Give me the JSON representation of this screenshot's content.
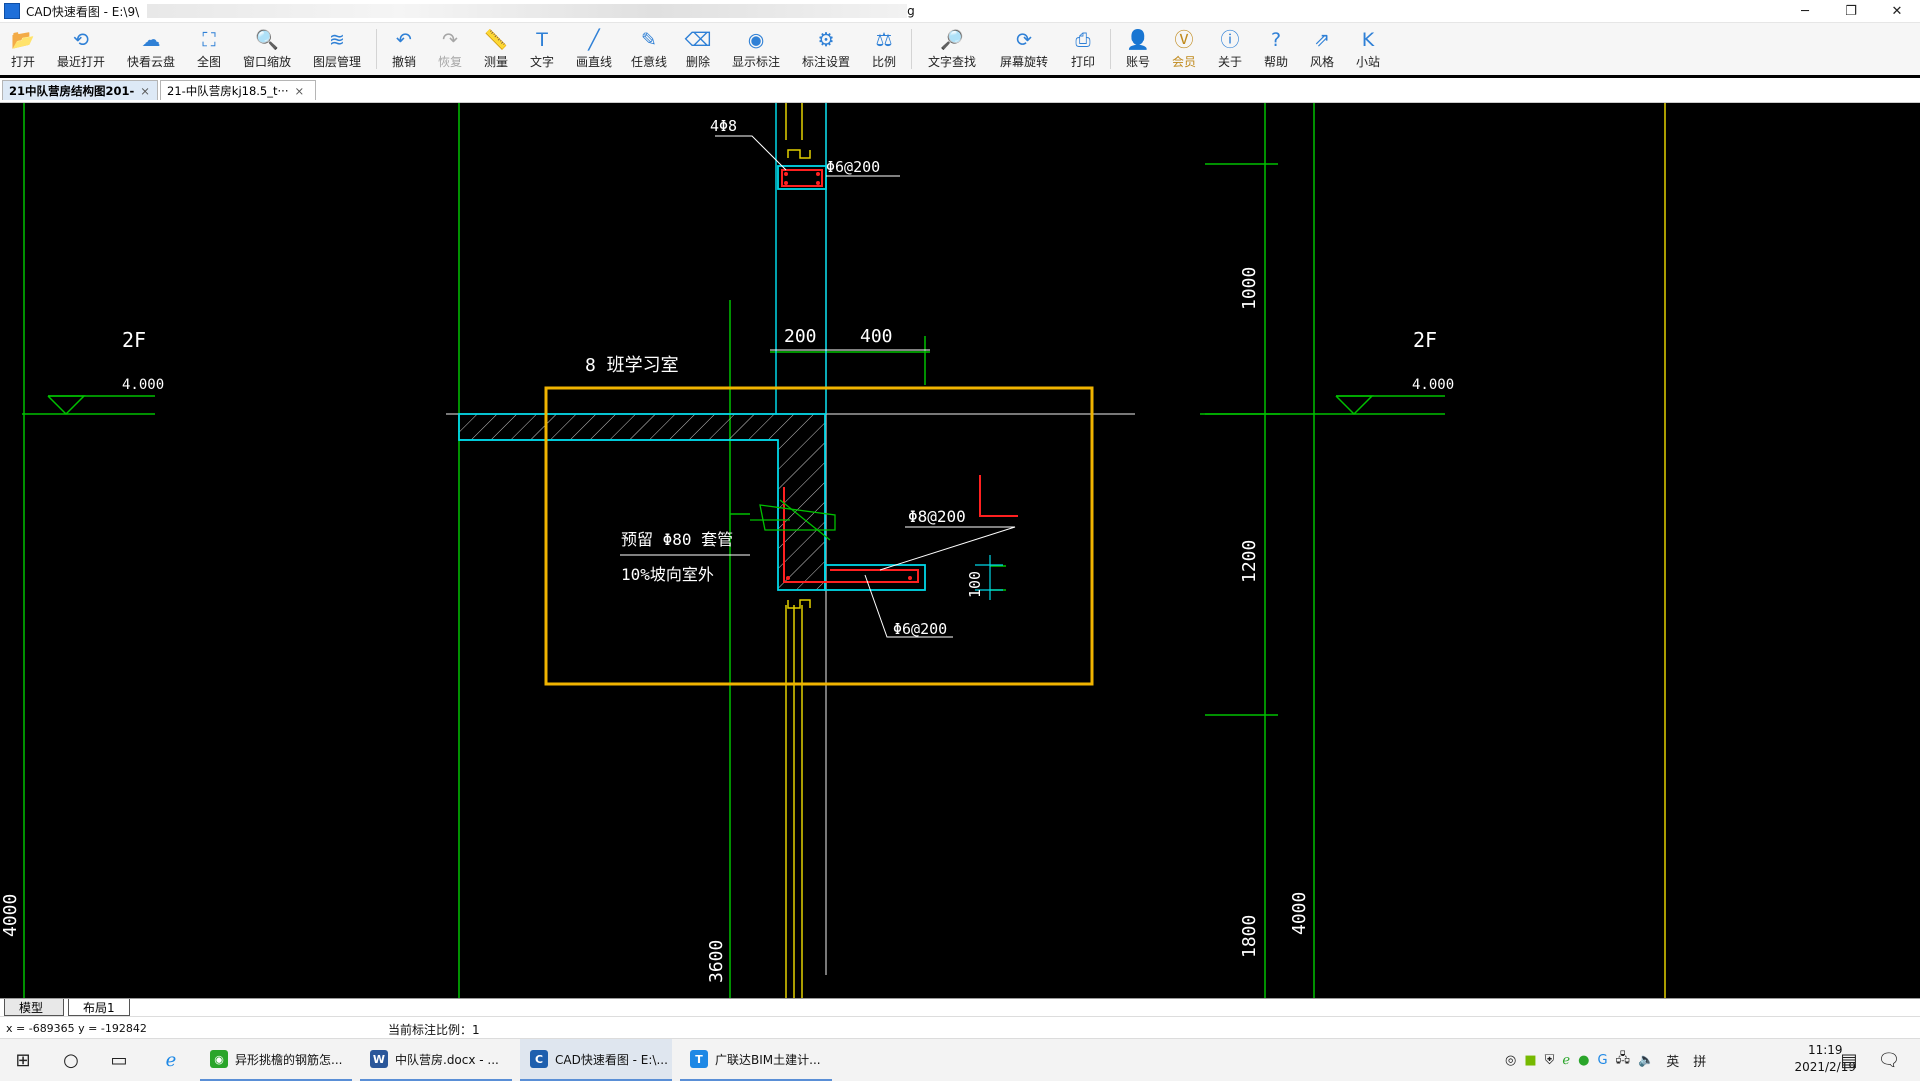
{
  "titlebar": {
    "app_title": "CAD快速看图 - E:\\9\\",
    "title_end": "g",
    "minimize": "─",
    "maximize": "❐",
    "close": "✕"
  },
  "toolbar": {
    "items": [
      {
        "label": "打开",
        "icon": "folder-open-icon",
        "glyph": "📂"
      },
      {
        "label": "最近打开",
        "icon": "history-icon",
        "glyph": "⟲"
      },
      {
        "label": "快看云盘",
        "icon": "cloud-icon",
        "glyph": "☁"
      },
      {
        "label": "全图",
        "icon": "fullview-icon",
        "glyph": "⛶"
      },
      {
        "label": "窗口缩放",
        "icon": "zoom-window-icon",
        "glyph": "🔍"
      },
      {
        "label": "图层管理",
        "icon": "layers-icon",
        "glyph": "≋"
      },
      {
        "label": "撤销",
        "icon": "undo-icon",
        "glyph": "↶"
      },
      {
        "label": "恢复",
        "icon": "redo-icon",
        "glyph": "↷"
      },
      {
        "label": "测量",
        "icon": "ruler-icon",
        "glyph": "📏"
      },
      {
        "label": "文字",
        "icon": "text-icon",
        "glyph": "T"
      },
      {
        "label": "画直线",
        "icon": "line-icon",
        "glyph": "╱"
      },
      {
        "label": "任意线",
        "icon": "freehand-icon",
        "glyph": "✎"
      },
      {
        "label": "删除",
        "icon": "eraser-icon",
        "glyph": "⌫"
      },
      {
        "label": "显示标注",
        "icon": "eye-icon",
        "glyph": "◉"
      },
      {
        "label": "标注设置",
        "icon": "annotation-settings-icon",
        "glyph": "⚙"
      },
      {
        "label": "比例",
        "icon": "scale-icon",
        "glyph": "⚖"
      },
      {
        "label": "文字查找",
        "icon": "text-search-icon",
        "glyph": "🔎"
      },
      {
        "label": "屏幕旋转",
        "icon": "rotate-screen-icon",
        "glyph": "⟳"
      },
      {
        "label": "打印",
        "icon": "printer-icon",
        "glyph": "⎙"
      },
      {
        "label": "账号",
        "icon": "user-icon",
        "glyph": "👤"
      },
      {
        "label": "会员",
        "icon": "vip-icon",
        "glyph": "Ⓥ"
      },
      {
        "label": "关于",
        "icon": "info-icon",
        "glyph": "ⓘ"
      },
      {
        "label": "帮助",
        "icon": "help-icon",
        "glyph": "?"
      },
      {
        "label": "风格",
        "icon": "style-icon",
        "glyph": "⇗"
      },
      {
        "label": "小站",
        "icon": "station-icon",
        "glyph": "K"
      }
    ]
  },
  "tabs": [
    {
      "label": "21中队营房结构图201-",
      "close": "×"
    },
    {
      "label": "21-中队营房kj18.5_t···",
      "close": "×"
    }
  ],
  "drawing": {
    "floor_left": "2F",
    "floor_right": "2F",
    "elev_left": "4.000",
    "elev_right": "4.000",
    "rebar_top": "4Φ8",
    "stirrup_top": "Φ6@200",
    "dim_200": "200",
    "dim_400": "400",
    "room": "8 班学习室",
    "rebar_slab": "Φ8@200",
    "rebar_bottom": "Φ6@200",
    "dim_100": "100",
    "note_1": "预留 Φ80 套管",
    "note_2": "10%坡向室外",
    "dim_1000": "1000",
    "dim_1200": "1200",
    "dim_1800": "1800",
    "dim_4000_right": "4000",
    "dim_4000_left": "4000",
    "dim_3600": "3600"
  },
  "layout_tabs": [
    "模型",
    "布局1"
  ],
  "status": {
    "coords": "x = -689365 y = -192842",
    "scale": "当前标注比例：1"
  },
  "taskbar": {
    "apps": [
      {
        "label": "异形挑檐的钢筋怎...",
        "icon": "wechat-icon"
      },
      {
        "label": "中队营房.docx - ...",
        "icon": "word-icon"
      },
      {
        "label": "CAD快速看图 - E:\\...",
        "icon": "cad-icon"
      },
      {
        "label": "广联达BIM土建计...",
        "icon": "glodon-icon"
      }
    ],
    "ime": "英",
    "ime2": "拼",
    "time": "11:19",
    "date": "2021/2/19"
  },
  "colors": {
    "background": "#000000",
    "grid_green": "#00c000",
    "cyan": "#00d8e8",
    "yellow_box": "#f0b400",
    "rebar_red": "#ff2020",
    "accent": "#2f80d6"
  }
}
